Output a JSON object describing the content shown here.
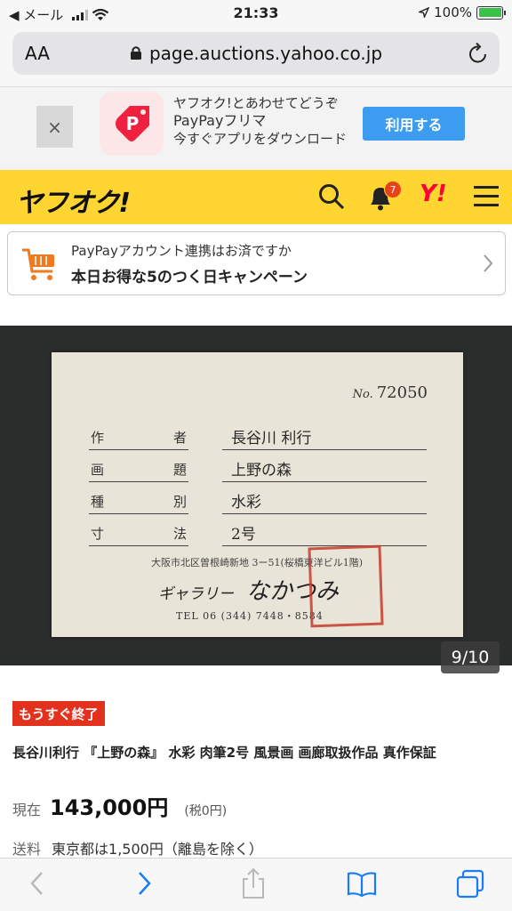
{
  "status_bar": {
    "back_app": "◀ メール",
    "time": "21:33",
    "battery_percent": "100%",
    "battery_level": 1.0
  },
  "browser": {
    "text_size_label": "AA",
    "url": "page.auctions.yahoo.co.jp"
  },
  "app_banner": {
    "close_label": "×",
    "line1": "ヤフオク!とあわせてどうぞ",
    "line2": "PayPayフリマ",
    "line3": "今すぐアプリをダウンロード",
    "button": "利用する"
  },
  "header": {
    "logo": "ヤフオク!",
    "notification_count": "7",
    "yahoo_logo": "Y!"
  },
  "campaign": {
    "line1": "PayPayアカウント連携はお済ですか",
    "line2": "本日お得な5のつく日キャンペーン"
  },
  "photo": {
    "card": {
      "number_prefix": "No.",
      "number": "72050",
      "rows": [
        {
          "label_a": "作",
          "label_b": "者",
          "value": "長谷川 利行"
        },
        {
          "label_a": "画",
          "label_b": "題",
          "value": "上野の森"
        },
        {
          "label_a": "種",
          "label_b": "別",
          "value": "水彩"
        },
        {
          "label_a": "寸",
          "label_b": "法",
          "value": "2号"
        }
      ],
      "address": "大阪市北区曽根崎新地 3ー51(桜橋東洋ビル1階)",
      "gallery_prefix": "ギャラリー",
      "gallery_name": "なかつみ",
      "tel": "TEL 06 (344) 7448・8584"
    },
    "counter": "9/10"
  },
  "item": {
    "ending_badge": "もうすぐ終了",
    "title": "長谷川利行 『上野の森』 水彩 肉筆2号 風景画 画廊取扱作品 真作保証",
    "price_label": "現在",
    "price": "143,000円",
    "tax": "(税0円)",
    "shipping_label": "送料",
    "shipping": "東京都は1,500円（離島を除く）"
  },
  "colors": {
    "yahoo_yellow": "#fed531",
    "accent_blue": "#3d9cf0",
    "badge_red": "#e2321e",
    "safari_blue": "#1a7cf5"
  }
}
